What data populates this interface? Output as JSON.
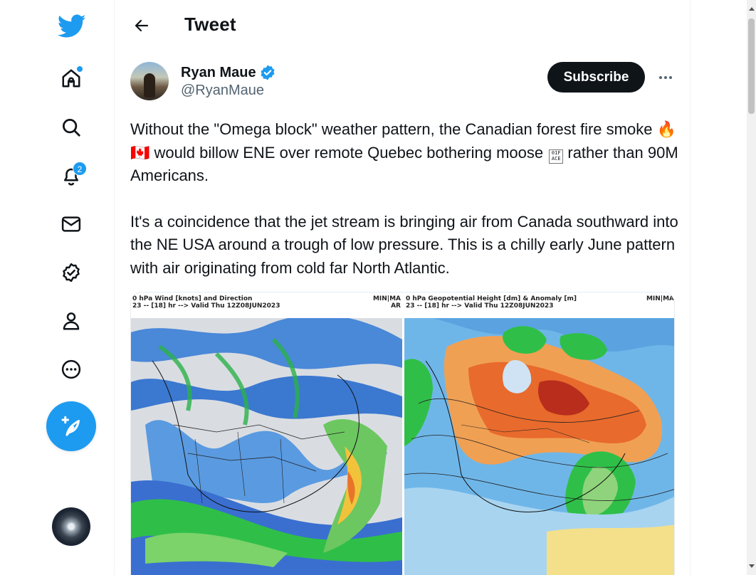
{
  "header": {
    "title": "Tweet"
  },
  "nav": {
    "badge_count": "2"
  },
  "tweet": {
    "author_name": "Ryan Maue",
    "author_handle": "@RyanMaue",
    "subscribe_label": "Subscribe",
    "paragraph1_a": "Without the \"Omega block\" weather pattern, the Canadian forest fire smoke ",
    "emoji_fire": "🔥",
    "emoji_flag": "🇨🇦",
    "paragraph1_b": " would billow ENE over remote Quebec bothering moose ",
    "paragraph1_c": " rather than 90M Americans.",
    "paragraph2": "It's a coincidence that the jet stream is bringing air from Canada southward into the NE USA around a trough of low pressure.  This is a chilly early June pattern with air originating from cold far North Atlantic."
  },
  "media": {
    "left_caption_line1": "0 hPa Wind [knots] and Direction",
    "left_caption_line2": "23 -- [18] hr --> Valid Thu 12Z08JUN2023",
    "left_caption_right1": "MIN|MA",
    "left_caption_right2": "AR",
    "right_caption_line1": "0 hPa Geopotential Height [dm] & Anomaly [m]",
    "right_caption_line2": "23 -- [18] hr --> Valid Thu 12Z08JUN2023",
    "right_caption_right1": "MIN|MA"
  },
  "colors": {
    "accent": "#1d9bf0",
    "text": "#0f1419",
    "secondary": "#536471"
  }
}
